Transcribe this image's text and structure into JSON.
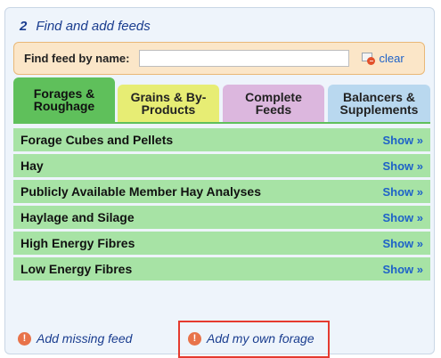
{
  "header": {
    "step": "2",
    "title": "Find and add feeds"
  },
  "search": {
    "label": "Find feed by name:",
    "value": "",
    "placeholder": "",
    "clear_label": "clear"
  },
  "tabs": [
    {
      "line1": "Forages &",
      "line2": "Roughage",
      "active": true
    },
    {
      "line1": "Grains & By-",
      "line2": "Products",
      "active": false
    },
    {
      "line1": "Complete",
      "line2": "Feeds",
      "active": false
    },
    {
      "line1": "Balancers &",
      "line2": "Supplements",
      "active": false
    }
  ],
  "categories": [
    {
      "label": "Forage Cubes and Pellets",
      "action": "Show »"
    },
    {
      "label": "Hay",
      "action": "Show »"
    },
    {
      "label": "Publicly Available Member Hay Analyses",
      "action": "Show »"
    },
    {
      "label": "Haylage and Silage",
      "action": "Show »"
    },
    {
      "label": "High Energy Fibres",
      "action": "Show »"
    },
    {
      "label": "Low Energy Fibres",
      "action": "Show »"
    }
  ],
  "footer": {
    "add_missing": "Add missing feed",
    "add_own": "Add my own forage",
    "icon_glyph": "!"
  },
  "colors": {
    "active_tab": "#5fc05b",
    "grains_tab": "#e7ed74",
    "complete_tab": "#dcb7de",
    "balancers_tab": "#b9d8ef",
    "row_bg": "#a7e3a5",
    "link": "#1e62c8",
    "highlight": "#e53a2f"
  }
}
